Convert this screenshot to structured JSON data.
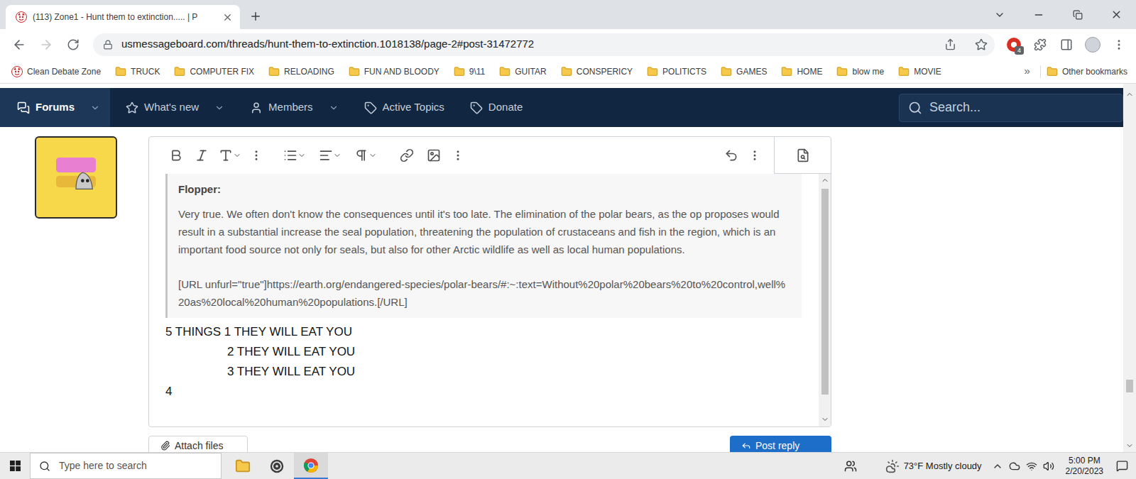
{
  "browser": {
    "tab": {
      "title": "(113) Zone1 - Hunt them to extinction..... | P",
      "selected": true
    },
    "address": "usmessageboard.com/threads/hunt-them-to-extinction.1018138/page-2#post-31472772",
    "extension_badge": "4",
    "bookmarks": [
      {
        "label": "Clean Debate Zone",
        "kind": "site"
      },
      {
        "label": "TRUCK",
        "kind": "folder"
      },
      {
        "label": "COMPUTER FIX",
        "kind": "folder"
      },
      {
        "label": "RELOADING",
        "kind": "folder"
      },
      {
        "label": "FUN AND BLOODY",
        "kind": "folder"
      },
      {
        "label": "9\\11",
        "kind": "folder"
      },
      {
        "label": "GUITAR",
        "kind": "folder"
      },
      {
        "label": "CONSPERICY",
        "kind": "folder"
      },
      {
        "label": "POLITICTS",
        "kind": "folder"
      },
      {
        "label": "GAMES",
        "kind": "folder"
      },
      {
        "label": "HOME",
        "kind": "folder"
      },
      {
        "label": "blow me",
        "kind": "folder"
      },
      {
        "label": "MOVIE",
        "kind": "folder"
      }
    ],
    "more_bookmarks": "»",
    "other_bookmarks": "Other bookmarks"
  },
  "site_nav": {
    "items": [
      {
        "label": "Forums",
        "selected": true,
        "dropdown": true
      },
      {
        "label": "What's new",
        "selected": false,
        "dropdown": true
      },
      {
        "label": "Members",
        "selected": false,
        "dropdown": true
      },
      {
        "label": "Active Topics",
        "selected": false,
        "dropdown": false
      },
      {
        "label": "Donate",
        "selected": false,
        "dropdown": false
      }
    ],
    "search": {
      "placeholder": "Search..."
    }
  },
  "editor": {
    "quote": {
      "author": "Flopper:",
      "text": "Very true. We often don't know the consequences until it's too late. The elimination of the polar bears, as the op proposes would result in a substantial increase the seal population, threatening the population of crustaceans and fish in the region, which is an important food source not only for seals, but also for other Arctic wildlife as well as local human populations.",
      "url": "[URL unfurl=\"true\"]https://earth.org/endangered-species/polar-bears/#:~:text=Without%20polar%20bears%20to%20control,well%20as%20local%20human%20populations.[/URL]"
    },
    "lines": [
      {
        "text": "5 THINGS 1 THEY WILL EAT YOU",
        "kind": "lead"
      },
      {
        "text": "2 THEY WILL EAT YOU",
        "kind": "indented"
      },
      {
        "text": "3 THEY WILL EAT YOU",
        "kind": "indented"
      },
      {
        "text": "4",
        "kind": "lead"
      }
    ]
  },
  "buttons": [
    {
      "label": "Attach files",
      "kind": "secondary"
    },
    {
      "label": "Post reply",
      "kind": "primary"
    }
  ],
  "taskbar": {
    "search_placeholder": "Type here to search",
    "weather": "73°F Mostly cloudy",
    "time": "5:00 PM",
    "date": "2/20/2023"
  }
}
